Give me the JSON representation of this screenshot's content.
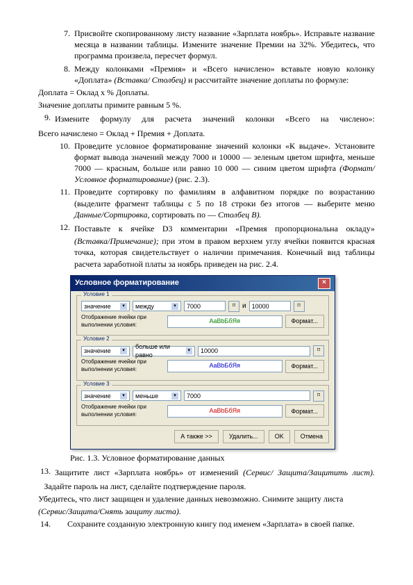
{
  "items": {
    "n7": "7.",
    "t7": "Присвойте скопированному листу название «Зарплата ноябрь». Исправьте название месяца в названии таблицы. Измените значение Премии на 32%. Убедитесь, что программа произвела, пересчет формул.",
    "n8": "8.",
    "t8a": "Между колонками «Премия» и «Всего начислено» вставьте новую колонку «Доплата» ",
    "t8b": "(Вставка/ Столбец)",
    "t8c": " и рассчитайте значение доплаты по формуле:"
  },
  "line_doplata": "Доплата = Оклад х % Доплаты.",
  "line_5pct": "Значение доплаты примите равным 5 %.",
  "n9": "9.",
  "t9": "Измените формулу для расчета значений колонки «Всего на числено»:",
  "line_vsego": "Всего начислено = Оклад + Премия + Доплата.",
  "n10": "10.",
  "t10a": "Проведите условное форматирование значений колонки «К выдаче». Установите формат вывода значений между 7000 и 10000 — зеленым цветом шрифта, меньше 7000 — красным, больше или равно 10 000 — синим цветом шрифта ",
  "t10b": "(Формат/Условное форматирование)",
  "t10c": " (рис. 2.3).",
  "n11": "11.",
  "t11a": "Проведите сортировку по фамилиям в алфавитном порядке по возрастанию (выделите фрагмент таблицы с 5 по 18 строки без итогов — выберите меню ",
  "t11b": "Данные/Сортировка",
  "t11c": ", сортировать по — ",
  "t11d": "Столбец В).",
  "n12": "12.",
  "t12a": "Поставьте к ячейке D3 комментарии «Премия пропорциональна окладу» ",
  "t12b": "(Вставка/Примечание);",
  "t12c": " при этом в правом верхнем углу ячейки появится красная точка, которая свидетельствует о наличии примечания. Конечный вид таблицы расчета заработной платы за ноябрь приведен на рис. 2.4.",
  "dialog": {
    "title": "Условное форматирование",
    "g1": "Условие 1",
    "g2": "Условие 2",
    "g3": "Условие 3",
    "combo_val": "значение",
    "op_between": "между",
    "op_ge": "больше или равно",
    "op_lt": "меньше",
    "and": "и",
    "v7000": "7000",
    "v10000": "10000",
    "sample_lbl": "Отображение ячейки при выполнении условия:",
    "sample1": "AaBbБбЯя",
    "sample2": "AaBbБбЯя",
    "sample3": "AaBbБбЯя",
    "btn_format": "Формат...",
    "btn_add": "А также >>",
    "btn_del": "Удалить...",
    "btn_ok": "OK",
    "btn_cancel": "Отмена"
  },
  "caption": "Рис. 1.3. Условное форматирование данных",
  "n13": "13.",
  "t13a": "Защитите лист «Зарплата ноябрь» от изменений ",
  "t13b": "(Сервис/ Защита/Защитить лист).",
  "t13c": " Задайте пароль на лист, сделайте подтверждение пароля.",
  "t13d": "Убедитесь, что лист защищен и удаление данных невозможно. Снимите защиту листа ",
  "t13e": "(Сервис/Защита/Снять защиту листа).",
  "n14": "14.",
  "t14": "Сохраните созданную электронную книгу под именем «Зарплата» в своей папке."
}
